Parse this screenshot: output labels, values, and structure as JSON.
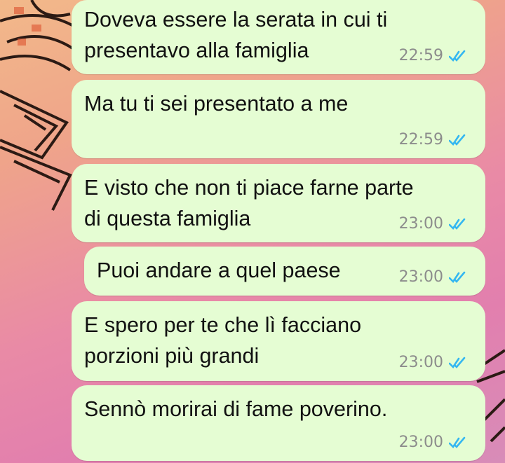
{
  "chat": {
    "messages": [
      {
        "text": "Doveva essere la serata in cui ti\npresentavo alla famiglia",
        "time": "22:59",
        "status": "read"
      },
      {
        "text": "Ma tu ti sei presentato a me",
        "time": "22:59",
        "status": "read"
      },
      {
        "text": "E visto che non ti piace farne parte\ndi questa famiglia",
        "time": "23:00",
        "status": "read"
      },
      {
        "text": "Puoi andare a quel paese",
        "time": "23:00",
        "status": "read"
      },
      {
        "text": "E spero per te che lì facciano\nporzioni più grandi",
        "time": "23:00",
        "status": "read"
      },
      {
        "text": "Sennò morirai di fame poverino.",
        "time": "23:00",
        "status": "read"
      }
    ]
  },
  "icons": {
    "read_receipt": "double-check-icon"
  },
  "colors": {
    "bubble": "#e5fdd3",
    "tick": "#34b7f1",
    "time": "#8c8c8c"
  }
}
